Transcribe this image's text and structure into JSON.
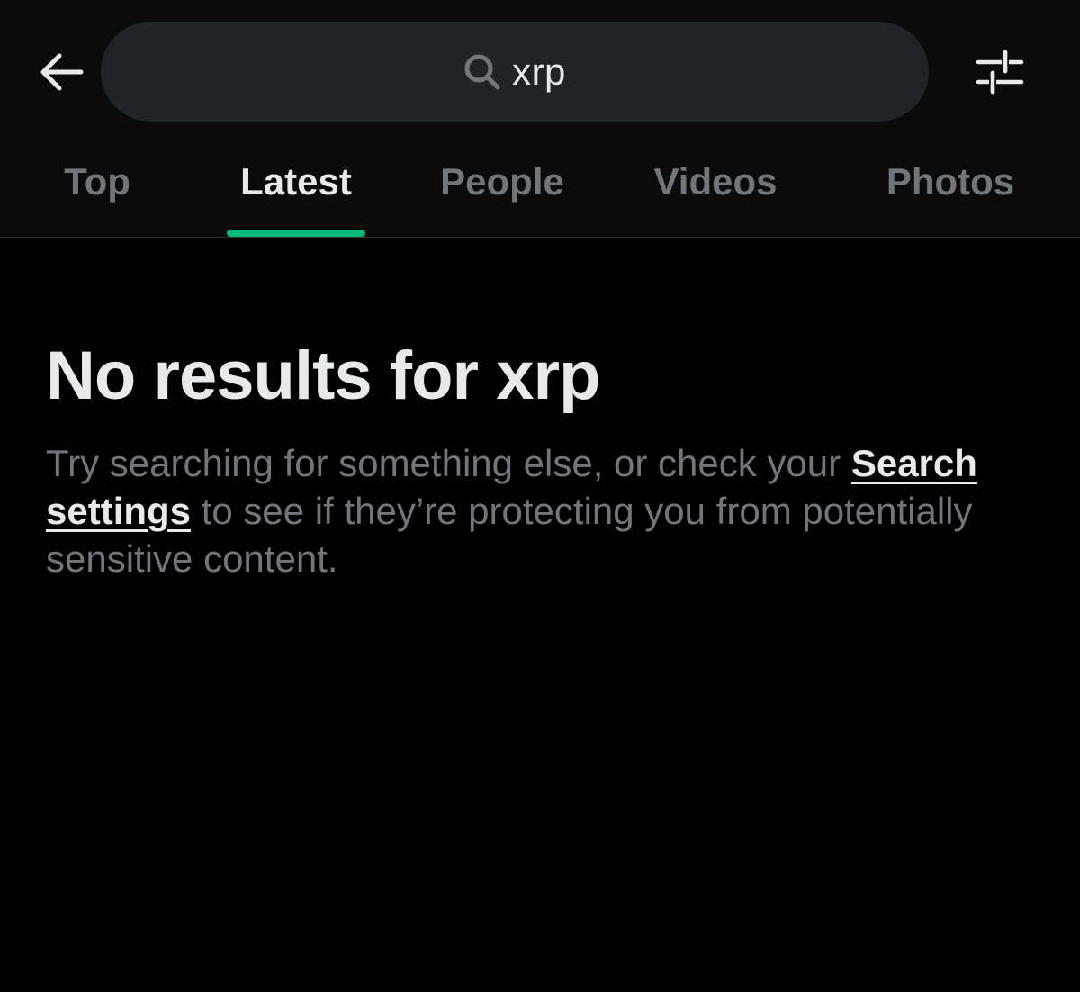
{
  "search": {
    "query": "xrp",
    "icon": "search-icon"
  },
  "header": {
    "back_icon": "arrow-left-icon",
    "filter_icon": "sliders-icon"
  },
  "tabs": [
    {
      "label": "Top",
      "active": false
    },
    {
      "label": "Latest",
      "active": true
    },
    {
      "label": "People",
      "active": false
    },
    {
      "label": "Videos",
      "active": false
    },
    {
      "label": "Photos",
      "active": false
    }
  ],
  "empty_state": {
    "title": "No results for xrp",
    "desc_before": "Try searching for something else, or check your ",
    "link": "Search settings",
    "desc_after": " to see if they’re protecting you from potentially sensitive content."
  },
  "colors": {
    "background": "#000000",
    "header_background": "#0b0b0c",
    "search_background": "#202327",
    "text_primary": "#e7e9ea",
    "text_secondary": "#71767b",
    "accent": "#00ba7c"
  }
}
